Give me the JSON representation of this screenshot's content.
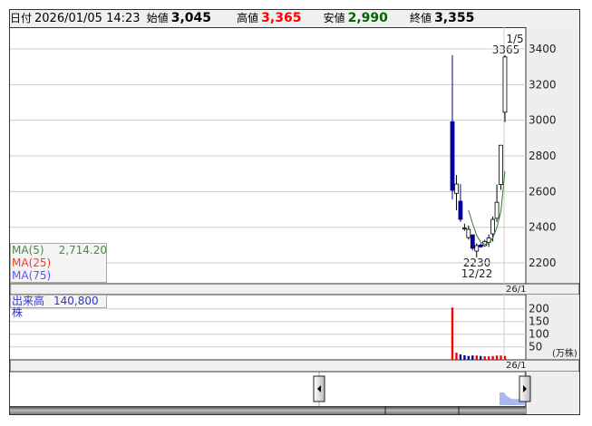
{
  "header": {
    "date_label": "日付",
    "date_value": "2026/01/05 14:23",
    "open_label": "始値",
    "open_value": "3,045",
    "high_label": "高値",
    "high_value": "3,365",
    "low_label": "安値",
    "low_value": "2,990",
    "close_label": "終値",
    "close_value": "3,355"
  },
  "legend": {
    "ma5_label": "MA(5)",
    "ma5_value": "2,714.20",
    "ma25_label": "MA(25)",
    "ma75_label": "MA(75)"
  },
  "volume_legend": {
    "label": "出来高",
    "value": "140,800株"
  },
  "colors": {
    "up": "#ffffff",
    "down": "#000099",
    "ma5": "#2e7d32",
    "ma25": "#ff3333",
    "ma75": "#5555ff",
    "vol_up": "#ff0000",
    "vol_down": "#000099",
    "high": "#ff0000",
    "low": "#006600"
  },
  "chart_data": {
    "type": "candlestick",
    "price_axis": {
      "ticks": [
        "2200",
        "2400",
        "2600",
        "2800",
        "3000",
        "3200",
        "3400"
      ],
      "ylim": [
        2150,
        3450
      ]
    },
    "date_axis_label": "26/1",
    "annotations": {
      "high_date": "1/5",
      "high_value": "3365",
      "low_value": "2230",
      "low_date": "12/22"
    },
    "candles": [
      {
        "o": 2992,
        "h": 3365,
        "l": 2556,
        "c": 2607
      },
      {
        "o": 2590,
        "h": 2693,
        "l": 2495,
        "c": 2642
      },
      {
        "o": 2546,
        "h": 2642,
        "l": 2430,
        "c": 2444
      },
      {
        "o": 2390,
        "h": 2420,
        "l": 2380,
        "c": 2395
      },
      {
        "o": 2342,
        "h": 2410,
        "l": 2330,
        "c": 2388
      },
      {
        "o": 2357,
        "h": 2360,
        "l": 2270,
        "c": 2282
      },
      {
        "o": 2266,
        "h": 2310,
        "l": 2230,
        "c": 2297
      },
      {
        "o": 2300,
        "h": 2310,
        "l": 2285,
        "c": 2290
      },
      {
        "o": 2297,
        "h": 2330,
        "l": 2290,
        "c": 2320
      },
      {
        "o": 2315,
        "h": 2360,
        "l": 2290,
        "c": 2340
      },
      {
        "o": 2363,
        "h": 2460,
        "l": 2320,
        "c": 2444
      },
      {
        "o": 2450,
        "h": 2640,
        "l": 2430,
        "c": 2540
      },
      {
        "o": 2640,
        "h": 2860,
        "l": 2610,
        "c": 2860
      },
      {
        "o": 3045,
        "h": 3365,
        "l": 2990,
        "c": 3355
      }
    ],
    "ma5": [
      null,
      null,
      null,
      null,
      2495,
      2420,
      2355,
      2315,
      2305,
      2307,
      2340,
      2398,
      2490,
      2714.2
    ],
    "volume": {
      "unit": "(万株)",
      "ticks": [
        "50",
        "100",
        "150",
        "200"
      ],
      "ylim": [
        0,
        220
      ],
      "values": [
        205,
        27,
        20,
        17,
        14,
        16,
        16,
        14,
        13,
        13,
        14,
        16,
        16,
        14.08
      ],
      "up": [
        true,
        true,
        false,
        false,
        false,
        false,
        true,
        false,
        true,
        true,
        true,
        true,
        true,
        true
      ]
    }
  }
}
